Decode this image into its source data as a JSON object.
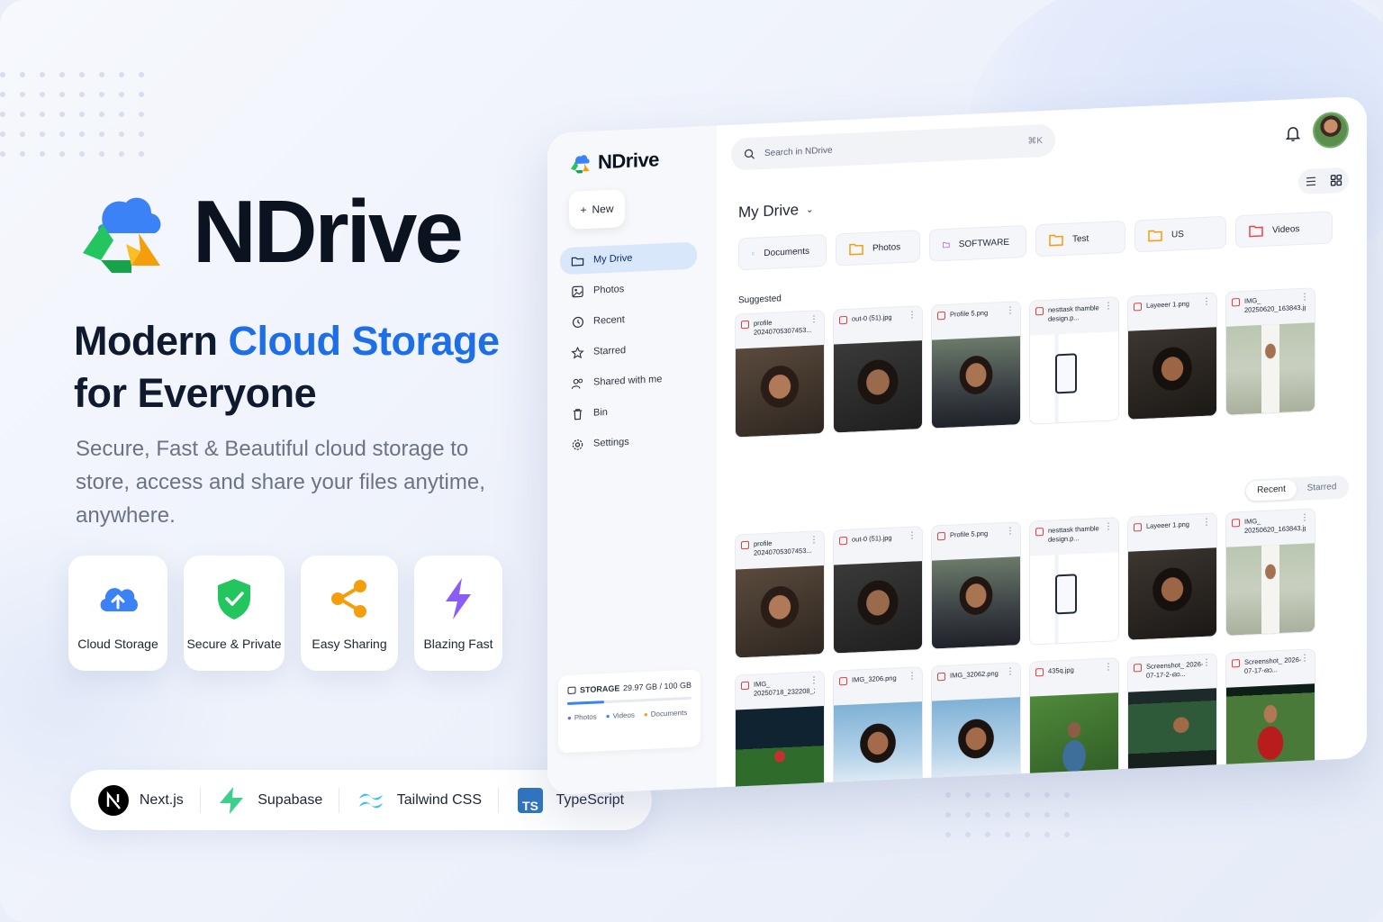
{
  "hero": {
    "brand": "NDrive",
    "headline_part1": "Modern ",
    "headline_accent": "Cloud Storage",
    "headline_part2": "for Everyone",
    "subtitle": "Secure, Fast & Beautiful cloud storage to store, access and share your files anytime, anywhere.",
    "features": [
      {
        "label": "Cloud Storage",
        "icon": "cloud-upload-icon",
        "color": "#3b82f6"
      },
      {
        "label": "Secure & Private",
        "icon": "shield-check-icon",
        "color": "#22c55e"
      },
      {
        "label": "Easy Sharing",
        "icon": "share-icon",
        "color": "#f59e0b"
      },
      {
        "label": "Blazing Fast",
        "icon": "lightning-icon",
        "color": "#8b5cf6"
      }
    ],
    "tech": [
      {
        "label": "Next.js",
        "icon": "nextjs-icon"
      },
      {
        "label": "Supabase",
        "icon": "supabase-icon"
      },
      {
        "label": "Tailwind CSS",
        "icon": "tailwind-icon"
      },
      {
        "label": "TypeScript",
        "icon": "typescript-icon",
        "badge": "TS"
      }
    ]
  },
  "app": {
    "brand": "NDrive",
    "new_label": "New",
    "search_placeholder": "Search in NDrive",
    "search_shortcut": "⌘K",
    "nav": [
      {
        "label": "My Drive",
        "icon": "folder-icon",
        "active": true
      },
      {
        "label": "Photos",
        "icon": "image-icon"
      },
      {
        "label": "Recent",
        "icon": "history-icon"
      },
      {
        "label": "Starred",
        "icon": "star-icon"
      },
      {
        "label": "Shared with me",
        "icon": "users-icon"
      },
      {
        "label": "Bin",
        "icon": "trash-icon"
      },
      {
        "label": "Settings",
        "icon": "gear-icon"
      }
    ],
    "storage": {
      "label": "STORAGE",
      "usage": "29.97 GB / 100 GB",
      "used_fraction": 0.2997,
      "legend": [
        "Photos",
        "Videos",
        "Documents"
      ]
    },
    "page_title": "My Drive",
    "folders": [
      {
        "name": "Documents",
        "color": "#38bdf8"
      },
      {
        "name": "Photos",
        "color": "#f59e0b"
      },
      {
        "name": "SOFTWARE",
        "color": "#a855f7"
      },
      {
        "name": "Test",
        "color": "#f59e0b"
      },
      {
        "name": "US",
        "color": "#f59e0b"
      },
      {
        "name": "Videos",
        "color": "#ef4444"
      }
    ],
    "suggested_label": "Suggested",
    "tabs": {
      "recent": "Recent",
      "starred": "Starred"
    },
    "suggested_files": [
      {
        "name": "profile 20240705307453...",
        "thumb": "t-portrait"
      },
      {
        "name": "out-0 (51).jpg",
        "thumb": "t-portrait2"
      },
      {
        "name": "Profile 5.png",
        "thumb": "t-portrait3"
      },
      {
        "name": "nesttask thamble design.p...",
        "thumb": "t-ui"
      },
      {
        "name": "Layeeer 1.png",
        "thumb": "t-portrait4"
      },
      {
        "name": "IMG_ 20250620_163843.jpg",
        "thumb": "t-outdoor"
      }
    ],
    "recent_files": [
      {
        "name": "profile 20240705307453...",
        "thumb": "t-portrait"
      },
      {
        "name": "out-0 (51).jpg",
        "thumb": "t-portrait2"
      },
      {
        "name": "Profile 5.png",
        "thumb": "t-portrait3"
      },
      {
        "name": "nesttask thamble design.p...",
        "thumb": "t-ui"
      },
      {
        "name": "Layeeer 1.png",
        "thumb": "t-portrait4"
      },
      {
        "name": "IMG_ 20250620_163843.jpg",
        "thumb": "t-outdoor"
      },
      {
        "name": "IMG_ 20250718_232208_22...",
        "thumb": "t-field"
      },
      {
        "name": "IMG_3206.png",
        "thumb": "t-sky"
      },
      {
        "name": "IMG_32062.png",
        "thumb": "t-sky"
      },
      {
        "name": "435q.jpg",
        "thumb": "t-green"
      },
      {
        "name": "Screenshot_ 2026-07-17-2-ഓ...",
        "thumb": "t-video"
      },
      {
        "name": "Screenshot_ 2026-07-17-ഓ...",
        "thumb": "t-video2"
      }
    ]
  }
}
